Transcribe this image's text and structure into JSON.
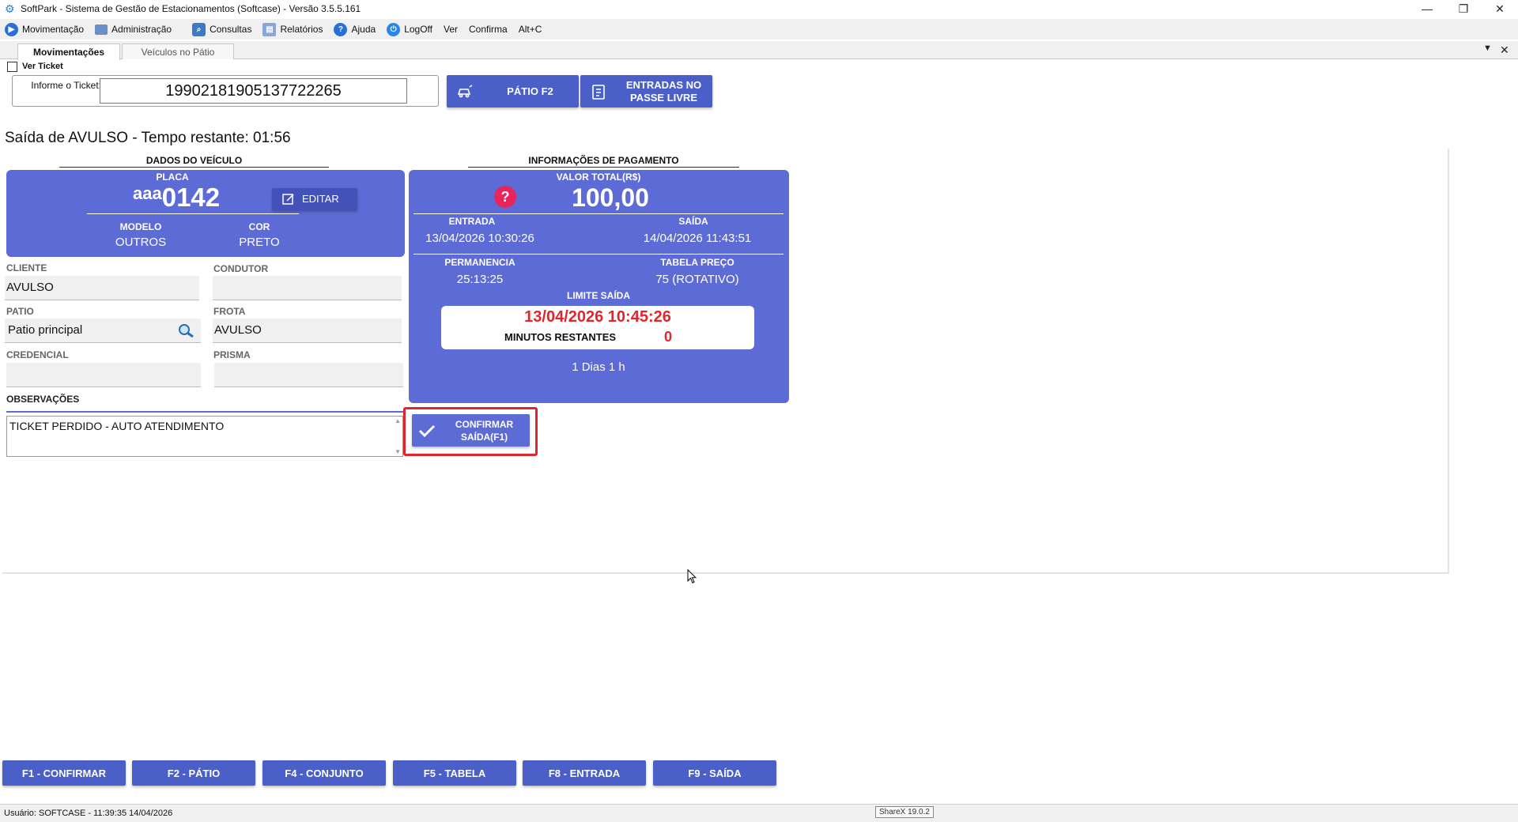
{
  "window": {
    "title": "SoftPark - Sistema de Gestão de Estacionamentos (Softcase) - Versão 3.5.5.161",
    "controls": [
      "—",
      "❐",
      "✕"
    ]
  },
  "menu": [
    {
      "label": "Movimentação",
      "icon": "play-icon",
      "color": "#2a6fd6"
    },
    {
      "label": "Administração",
      "icon": "monitor-icon",
      "color": "#3a7bd5"
    },
    {
      "label": "Consultas",
      "icon": "magnifier-icon",
      "color": "#2a6fd6"
    },
    {
      "label": "Relatórios",
      "icon": "report-icon",
      "color": "#5a86c8"
    },
    {
      "label": "Ajuda",
      "icon": "help-icon",
      "color": "#2a6fd6"
    },
    {
      "label": "LogOff",
      "icon": "power-icon",
      "color": "#2a86e6"
    },
    {
      "label": "Ver",
      "icon": "",
      "color": ""
    },
    {
      "label": "Confirma",
      "icon": "",
      "color": ""
    },
    {
      "label": "Alt+C",
      "icon": "",
      "color": ""
    }
  ],
  "tabs": [
    {
      "label": "Movimentações",
      "active": true
    },
    {
      "label": "Veículos no Pátio",
      "active": false
    }
  ],
  "ver_ticket": {
    "label": "Ver Ticket",
    "checked": false
  },
  "ticket": {
    "label": "Informe o Ticket:",
    "value": "19902181905137722265"
  },
  "buttons": {
    "patio": "PÁTIO F2",
    "entradas": "ENTRADAS NO PASSE LIVRE",
    "editar": "EDITAR",
    "confirmar": "CONFIRMAR SAÍDA(F1)"
  },
  "heading": "Saída de AVULSO - Tempo restante: 01:56",
  "vehicle": {
    "section_title": "DADOS DO VEÍCULO",
    "placa_label": "PLACA",
    "placa_prefix": "aaa",
    "placa_number": "0142",
    "modelo_label": "MODELO",
    "modelo": "OUTROS",
    "cor_label": "COR",
    "cor": "PRETO"
  },
  "fields": {
    "cliente_label": "CLIENTE",
    "cliente": "AVULSO",
    "condutor_label": "CONDUTOR",
    "condutor": "",
    "patio_label": "PATIO",
    "patio": "Patio principal",
    "frota_label": "FROTA",
    "frota": "AVULSO",
    "credencial_label": "CREDENCIAL",
    "credencial": "",
    "prisma_label": "PRISMA",
    "prisma": "",
    "observacoes_label": "OBSERVAÇÕES",
    "observacoes": "TICKET PERDIDO - AUTO ATENDIMENTO"
  },
  "payment": {
    "section_title": "INFORMAÇÕES DE PAGAMENTO",
    "valor_label": "VALOR TOTAL(R$)",
    "valor": "100,00",
    "entrada_label": "ENTRADA",
    "entrada": "13/04/2026 10:30:26",
    "saida_label": "SAÍDA",
    "saida": "14/04/2026 11:43:51",
    "permanencia_label": "PERMANENCIA",
    "permanencia": "25:13:25",
    "tabela_label": "TABELA PREÇO",
    "tabela": "75 (ROTATIVO)",
    "limite_label": "LIMITE SAÍDA",
    "limite": "13/04/2026 10:45:26",
    "minutos_label": "MINUTOS RESTANTES",
    "minutos": "0",
    "duracao": "1 Dias 1 h"
  },
  "fkeys": [
    "F1 - CONFIRMAR",
    "F2 - PÁTIO",
    "F4 - CONJUNTO",
    "F5 - TABELA",
    "F8 - ENTRADA",
    "F9 - SAÍDA"
  ],
  "status": {
    "text": "Usuário:  SOFTCASE - 11:39:35 14/04/2026",
    "sharex": "ShareX 19.0.2"
  },
  "colors": {
    "card": "#5d6bd6",
    "button": "#4b5fc9",
    "alert": "#e0262c",
    "help": "#e8245a"
  }
}
